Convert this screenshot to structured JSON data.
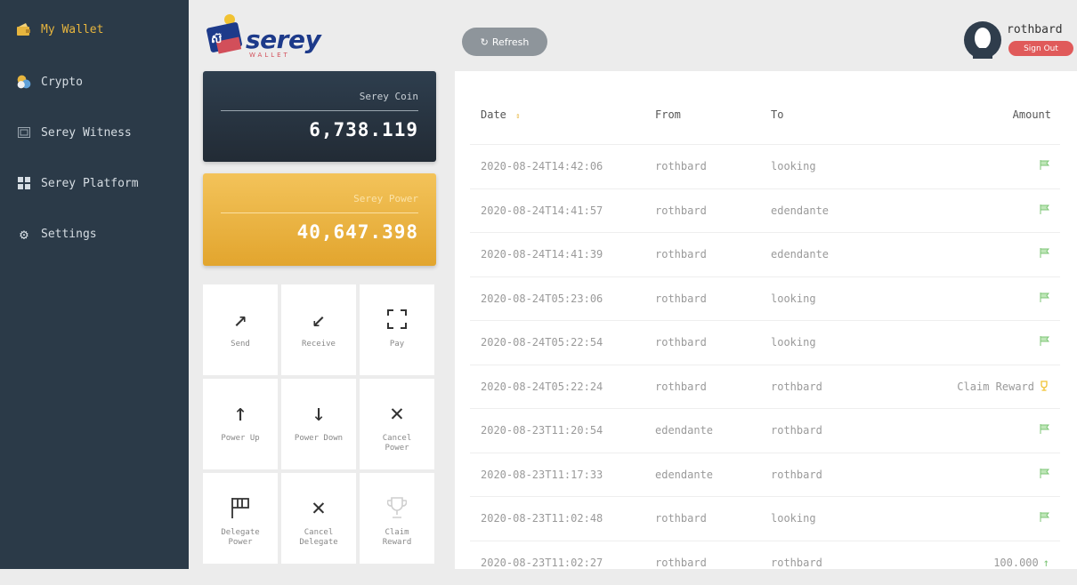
{
  "sidebar": {
    "items": [
      {
        "label": "My Wallet",
        "icon": "wallet-icon",
        "active": true
      },
      {
        "label": "Crypto",
        "icon": "crypto-coins-icon"
      },
      {
        "label": "Serey Witness",
        "icon": "witness-icon"
      },
      {
        "label": "Serey Platform",
        "icon": "platform-grid-icon"
      },
      {
        "label": "Settings",
        "icon": "gear-icon"
      }
    ]
  },
  "logo": {
    "text": "serey",
    "sub": "WALLET",
    "brand_color": "#1d3a8a"
  },
  "balances": {
    "coin": {
      "label": "Serey Coin",
      "value": "6,738.119"
    },
    "power": {
      "label": "Serey Power",
      "value": "40,647.398"
    }
  },
  "actions": [
    {
      "label": "Send",
      "glyph": "↗",
      "icon": "send-arrow-icon"
    },
    {
      "label": "Receive",
      "glyph": "↙",
      "icon": "receive-arrow-icon"
    },
    {
      "label": "Pay",
      "glyph": "⛶",
      "icon": "scan-frame-icon"
    },
    {
      "label": "Power Up",
      "glyph": "↑",
      "icon": "arrow-up-icon"
    },
    {
      "label": "Power Down",
      "glyph": "↓",
      "icon": "arrow-down-icon"
    },
    {
      "label": "Cancel Power",
      "glyph": "✕",
      "icon": "close-icon"
    },
    {
      "label": "Delegate Power",
      "glyph": "⚑",
      "icon": "delegate-flag-icon"
    },
    {
      "label": "Cancel Delegate",
      "glyph": "✕",
      "icon": "close-icon"
    },
    {
      "label": "Claim Reward",
      "glyph": "🏆",
      "icon": "trophy-icon",
      "disabled": true
    }
  ],
  "header": {
    "refresh_label": "Refresh",
    "username": "rothbard",
    "signout_label": "Sign Out"
  },
  "table": {
    "columns": {
      "date": "Date",
      "from": "From",
      "to": "To",
      "amount": "Amount"
    },
    "rows": [
      {
        "date": "2020-08-24T14:42:06",
        "from": "rothbard",
        "to": "looking",
        "amount": "",
        "icon": "flag"
      },
      {
        "date": "2020-08-24T14:41:57",
        "from": "rothbard",
        "to": "edendante",
        "amount": "",
        "icon": "flag"
      },
      {
        "date": "2020-08-24T14:41:39",
        "from": "rothbard",
        "to": "edendante",
        "amount": "",
        "icon": "flag"
      },
      {
        "date": "2020-08-24T05:23:06",
        "from": "rothbard",
        "to": "looking",
        "amount": "",
        "icon": "flag"
      },
      {
        "date": "2020-08-24T05:22:54",
        "from": "rothbard",
        "to": "looking",
        "amount": "",
        "icon": "flag"
      },
      {
        "date": "2020-08-24T05:22:24",
        "from": "rothbard",
        "to": "rothbard",
        "amount": "Claim Reward",
        "icon": "trophy"
      },
      {
        "date": "2020-08-23T11:20:54",
        "from": "edendante",
        "to": "rothbard",
        "amount": "",
        "icon": "flag"
      },
      {
        "date": "2020-08-23T11:17:33",
        "from": "edendante",
        "to": "rothbard",
        "amount": "",
        "icon": "flag"
      },
      {
        "date": "2020-08-23T11:02:48",
        "from": "rothbard",
        "to": "looking",
        "amount": "",
        "icon": "flag"
      },
      {
        "date": "2020-08-23T11:02:27",
        "from": "rothbard",
        "to": "rothbard",
        "amount": "100.000",
        "icon": "arrow-up"
      }
    ]
  },
  "colors": {
    "accent_gold": "#e7b53e",
    "sidebar_bg": "#2b3a48",
    "flag_green": "#7cc576",
    "signout_red": "#e05a5a"
  }
}
